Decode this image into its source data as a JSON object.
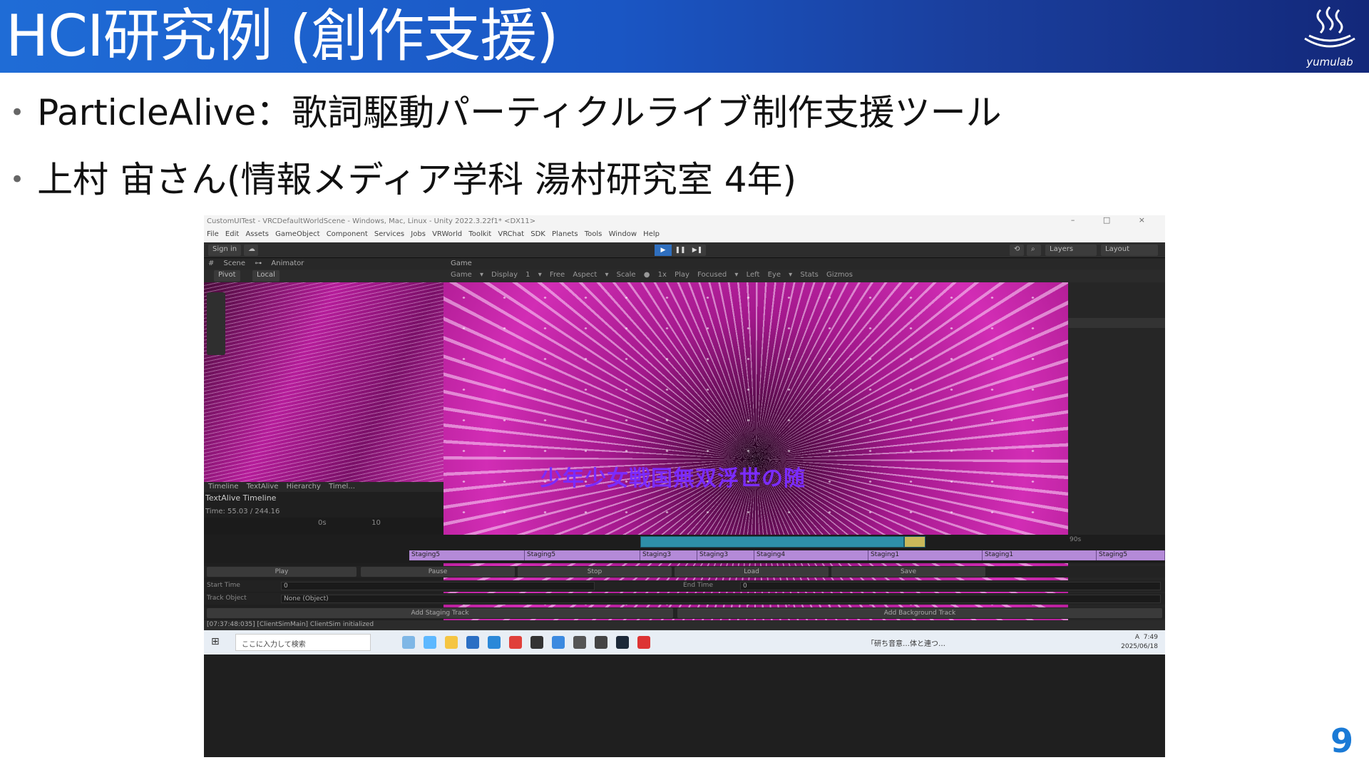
{
  "slide": {
    "title": "HCI研究例 (創作支援)",
    "logo_text": "yumulab",
    "bullets": [
      "ParticleAlive：歌詞駆動パーティクルライブ制作支援ツール",
      "上村 宙さん(情報メディア学科 湯村研究室 4年)"
    ],
    "bullet_marker": "•",
    "page_number": "9",
    "colors": {
      "header_left": "#1f6cd6",
      "header_right": "#13287a",
      "page_number": "#1a7ad6"
    }
  },
  "unity": {
    "window_title": "CustomUITest - VRCDefaultWorldScene - Windows, Mac, Linux - Unity 2022.3.22f1* <DX11>",
    "window_buttons": "– □ ×",
    "menu": "File Edit Assets GameObject Component Services Jobs VRWorld Toolkit VRChat SDK Planets Tools Window Help",
    "sign_in": "Sign in",
    "play_icons": [
      "▶",
      "❚❚",
      "▶❚"
    ],
    "layers": "Layers",
    "layout": "Layout",
    "scene_tabs": "# Scene  ⊶ Animator",
    "scene_pivot": "Pivot",
    "scene_local": "Local",
    "game_tab": "Game",
    "game_controls": "Game ▾  Display 1 ▾  Free Aspect ▾  Scale ● 1x  Play Focused ▾  Left Eye ▾  Stats  Gizmos",
    "lyric_overlay": "少年少女戦国無双浮世の随",
    "timeline_tabs": "Timeline  TextAlive Hierarchy Timel...",
    "timeline_title": "TextAlive Timeline",
    "timeline_time": "Time: 55.03 / 244.16",
    "ruler": [
      "0s",
      "10"
    ],
    "ruler_end": "90s",
    "staging_clips": [
      {
        "label": "Staging5",
        "color": "#b48ad8"
      },
      {
        "label": "Staging5",
        "color": "#b48ad8"
      },
      {
        "label": "Staging3",
        "color": "#b48ad8"
      },
      {
        "label": "Staging3",
        "color": "#b48ad8"
      },
      {
        "label": "Staging4",
        "color": "#b48ad8"
      },
      {
        "label": "Staging1",
        "color": "#b48ad8"
      },
      {
        "label": "Staging1",
        "color": "#b48ad8"
      },
      {
        "label": "Staging5",
        "color": "#b48ad8"
      }
    ],
    "buttons": [
      "Play",
      "Pause",
      "Stop",
      "Load",
      "Save"
    ],
    "start_time_label": "Start Time",
    "start_time_value": "0",
    "end_time_label": "End Time",
    "end_time_value": "0",
    "track_object_label": "Track Object",
    "track_object_value": "None (Object)",
    "add_staging": "Add Staging Track",
    "add_background": "Add Background Track",
    "console": "[07:37:48:035] [ClientSimMain] ClientSim initialized"
  },
  "taskbar": {
    "search_placeholder": "ここに入力して検索",
    "running_app": "「研ち音意…体と連つ…",
    "ime": "A",
    "time": "7:49",
    "date": "2025/06/18"
  }
}
